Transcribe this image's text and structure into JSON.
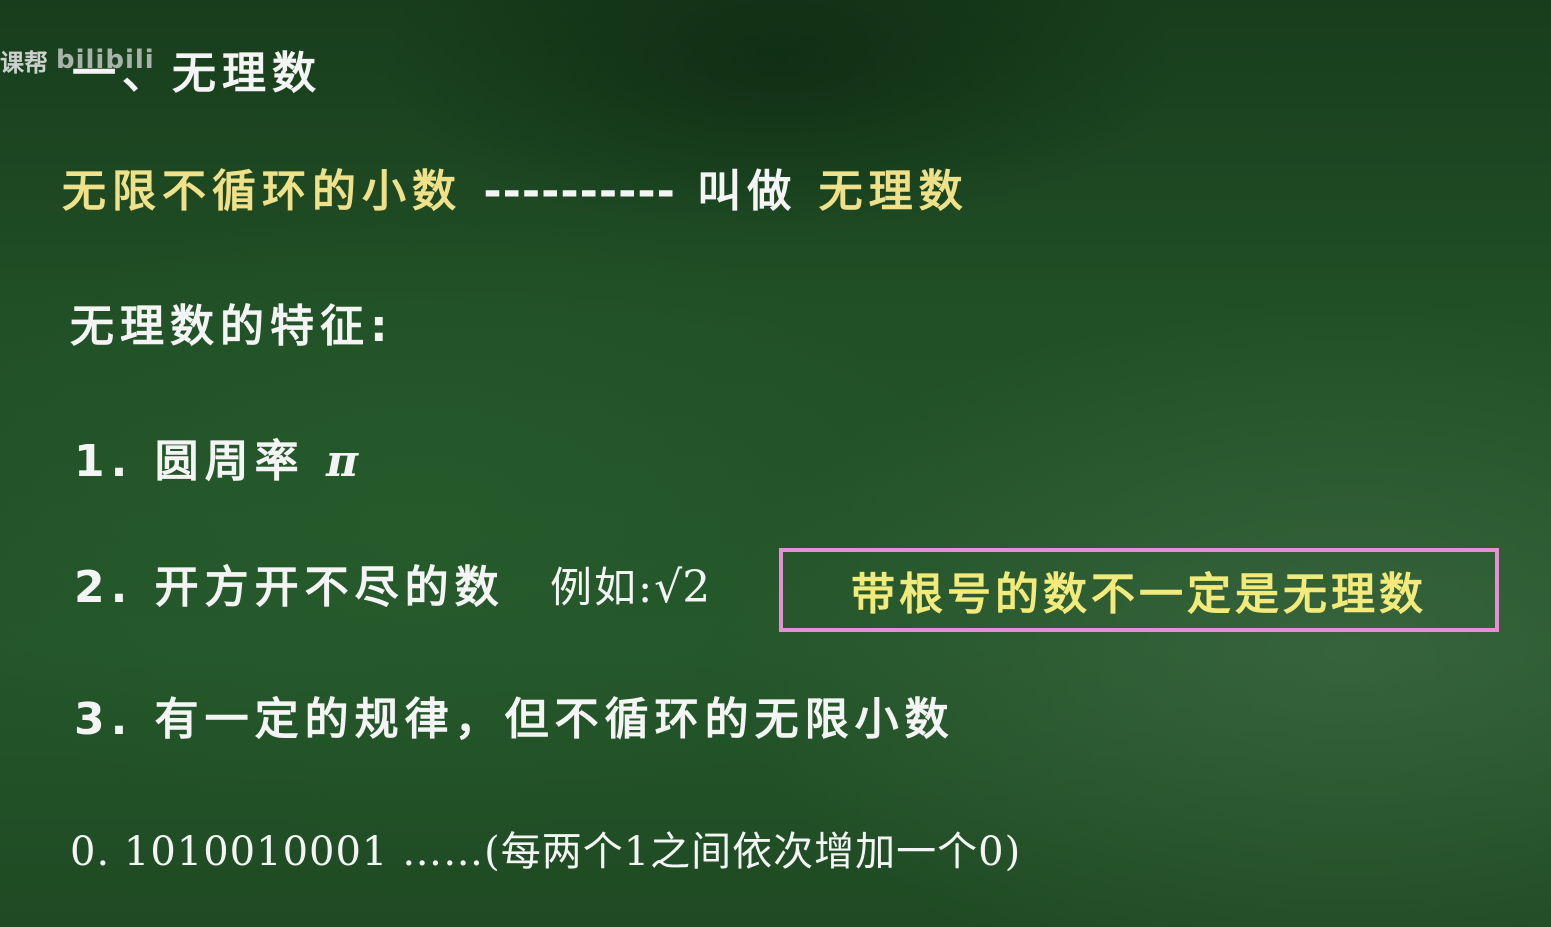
{
  "watermark": {
    "text": "课帮",
    "logo": "bilibili"
  },
  "heading": "一、无理数",
  "definition": {
    "term": "无限不循环的小数",
    "dashes": "----------",
    "verb": "叫做",
    "result": "无理数"
  },
  "features_title": "无理数的特征:",
  "items": [
    {
      "num": "1.",
      "text": "圆周率",
      "symbol": "π"
    },
    {
      "num": "2.",
      "text": "开方开不尽的数",
      "example_label": "例如:",
      "example_value": "√2"
    },
    {
      "num": "3.",
      "text": "有一定的规律，但不循环的无限小数"
    }
  ],
  "example_number": "0. 1010010001 ……(每两个1之间依次增加一个0)",
  "callout": "带根号的数不一定是无理数",
  "colors": {
    "board": "#1e4a22",
    "highlight_yellow": "#efe08a",
    "callout_border": "#e58fd6",
    "callout_text": "#f2ea7a"
  }
}
